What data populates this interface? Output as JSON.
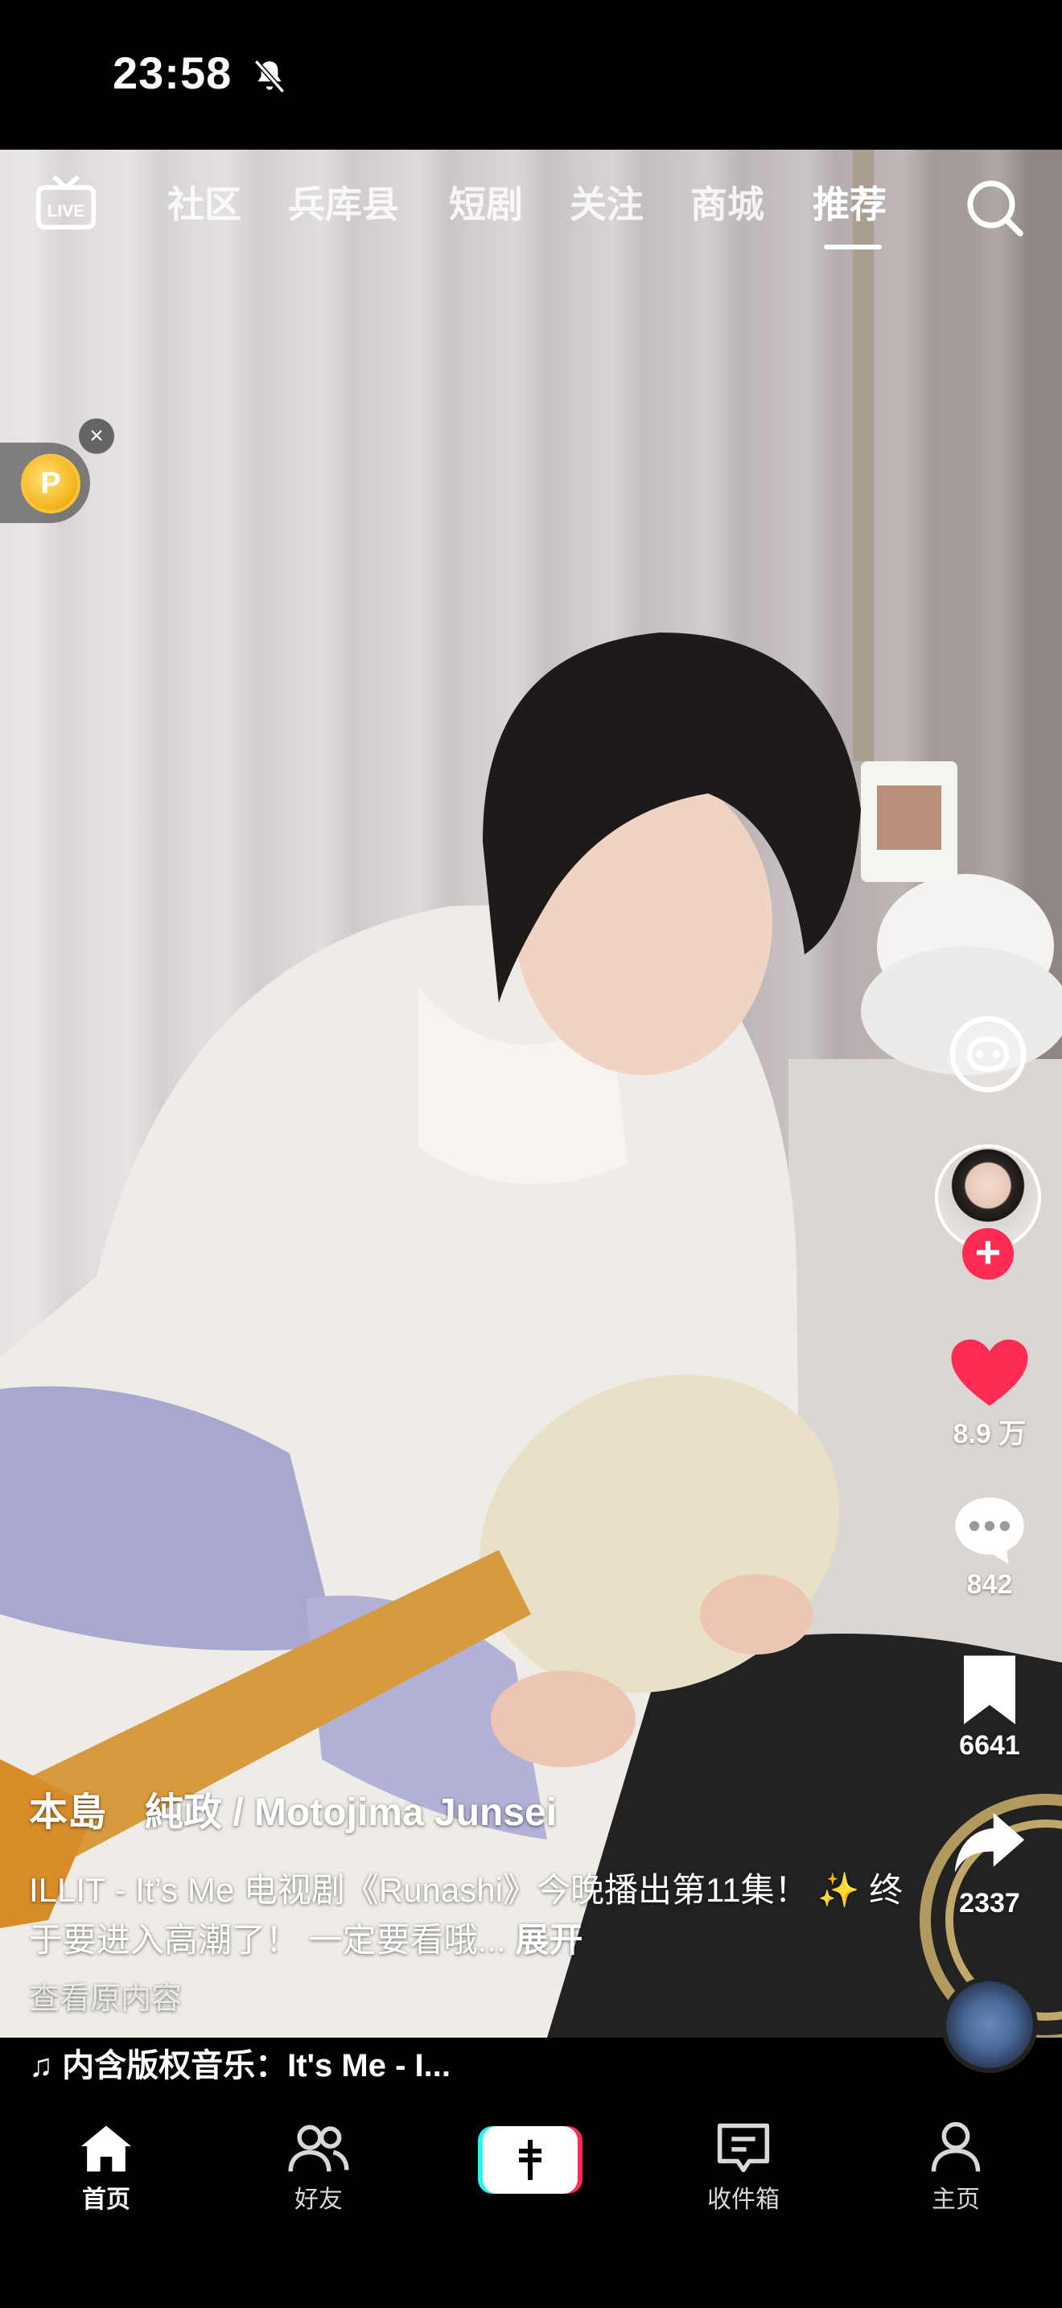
{
  "status_bar": {
    "time": "23:58"
  },
  "top_nav": {
    "tabs": [
      "社区",
      "兵库县",
      "短剧",
      "关注",
      "商城",
      "推荐"
    ],
    "active_index": 5
  },
  "side_widget": {
    "coin_glyph": "P"
  },
  "rail": {
    "likes": "8.9 万",
    "comments": "842",
    "favorites": "6641",
    "shares": "2337"
  },
  "caption": {
    "author": "本島　純政 /  Motojima Junsei",
    "description": "ILLIT - It’s Me 电视剧《Runashi》今晚播出第11集！ ✨ 终于要进入高潮了！ 一定要看哦...",
    "expand_label": "展开",
    "view_original": "查看原内容",
    "music": "♫ 内含版权音乐：It's Me - I..."
  },
  "bottom_tabs": {
    "home": "首页",
    "friends": "好友",
    "inbox": "收件箱",
    "profile": "主页"
  },
  "colors": {
    "like": "#fe2c55",
    "accent_cyan": "#25f4ee",
    "accent_red": "#fe2c55"
  }
}
